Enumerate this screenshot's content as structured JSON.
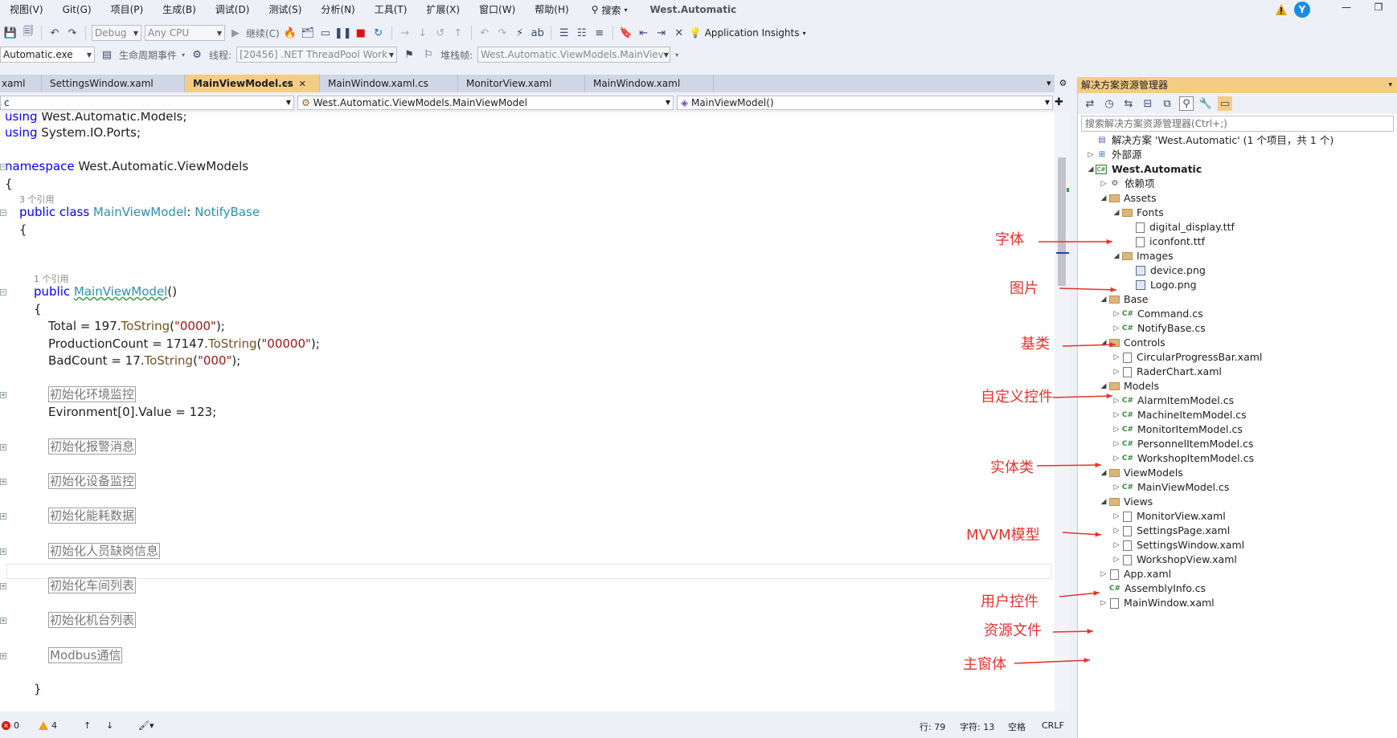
{
  "menubar": {
    "items": [
      "视图(V)",
      "Git(G)",
      "项目(P)",
      "生成(B)",
      "调试(D)",
      "测试(S)",
      "分析(N)",
      "工具(T)",
      "扩展(X)",
      "窗口(W)",
      "帮助(H)"
    ],
    "search_label": "搜索",
    "solution_title": "West.Automatic",
    "avatar_letter": "Y",
    "minimize": "—",
    "restore": "❐"
  },
  "toolbar": {
    "config": "Debug",
    "platform": "Any CPU",
    "continue_label": "继续(C)",
    "app_insights": "Application Insights",
    "process": "Automatic.exe",
    "lifecycle_label": "生命周期事件",
    "thread_label": "线程:",
    "thread_value": "[20456] .NET ThreadPool Work",
    "stack_label": "堆栈帧:",
    "stack_value": "West.Automatic.ViewModels.MainViev"
  },
  "tabs": [
    {
      "label": "xaml"
    },
    {
      "label": "SettingsWindow.xaml"
    },
    {
      "label": "MainViewModel.cs",
      "active": true
    },
    {
      "label": "MainWindow.xaml.cs"
    },
    {
      "label": "MonitorView.xaml"
    },
    {
      "label": "MainWindow.xaml"
    }
  ],
  "navbar": {
    "left": "c",
    "middle": "West.Automatic.ViewModels.MainViewModel",
    "right": "MainViewModel()"
  },
  "code": {
    "using1_kw": "using",
    "using1_rest": " West.Automatic.Models;",
    "using2_kw": "using",
    "using2_rest": " System.IO.Ports;",
    "ns_kw": "namespace",
    "ns_rest": " West.Automatic.ViewModels",
    "brace_open": "{",
    "class_refs": "3 个引用",
    "class_kw": "public class ",
    "class_name": "MainViewModel",
    "class_colon": ": ",
    "class_base": "NotifyBase",
    "ctor_refs": "1 个引用",
    "ctor_kw": "public ",
    "ctor_name": "MainViewModel",
    "ctor_parens": "()",
    "total_a": "Total = 197.",
    "total_m": "ToString",
    "total_b": "(",
    "total_s": "\"0000\"",
    "total_c": ");",
    "prod_a": "ProductionCount = 17147.",
    "prod_m": "ToString",
    "prod_b": "(",
    "prod_s": "\"00000\"",
    "prod_c": ");",
    "bad_a": "BadCount = 17.",
    "bad_m": "ToString",
    "bad_b": "(",
    "bad_s": "\"000\"",
    "bad_c": ");",
    "region_env": "初始化环境监控",
    "env_line": "Evironment[0].Value = 123;",
    "region_alarm": "初始化报警消息",
    "region_device": "初始化设备监控",
    "region_energy": "初始化能耗数据",
    "region_personnel": "初始化人员缺岗信息",
    "region_workshop": "初始化车间列表",
    "region_machine": "初始化机台列表",
    "region_modbus": "Modbus通信",
    "brace_close": "}"
  },
  "solution_explorer": {
    "title": "解决方案资源管理器",
    "search_placeholder": "搜索解决方案资源管理器(Ctrl+;)",
    "tree": [
      {
        "label": "解决方案 'West.Automatic' (1 个项目，共 1 个)",
        "icon": "solution-icon"
      },
      {
        "label": "外部源",
        "icon": "external-icon"
      },
      {
        "label": "West.Automatic",
        "icon": "project-icon"
      },
      {
        "label": "依赖项",
        "icon": "dependencies-icon"
      },
      {
        "label": "Assets",
        "icon": "folder-icon"
      },
      {
        "label": "Fonts",
        "icon": "folder-icon"
      },
      {
        "label": "digital_display.ttf",
        "icon": "font-file-icon"
      },
      {
        "label": "iconfont.ttf",
        "icon": "font-file-icon"
      },
      {
        "label": "Images",
        "icon": "folder-icon"
      },
      {
        "label": "device.png",
        "icon": "image-file-icon"
      },
      {
        "label": "Logo.png",
        "icon": "image-file-icon"
      },
      {
        "label": "Base",
        "icon": "folder-icon"
      },
      {
        "label": "Command.cs",
        "icon": "csharp-file-icon"
      },
      {
        "label": "NotifyBase.cs",
        "icon": "csharp-file-icon"
      },
      {
        "label": "Controls",
        "icon": "folder-icon"
      },
      {
        "label": "CircularProgressBar.xaml",
        "icon": "xaml-file-icon"
      },
      {
        "label": "RaderChart.xaml",
        "icon": "xaml-file-icon"
      },
      {
        "label": "Models",
        "icon": "folder-icon"
      },
      {
        "label": "AlarmItemModel.cs",
        "icon": "csharp-file-icon"
      },
      {
        "label": "MachineItemModel.cs",
        "icon": "csharp-file-icon"
      },
      {
        "label": "MonitorItemModel.cs",
        "icon": "csharp-file-icon"
      },
      {
        "label": "PersonnelItemModel.cs",
        "icon": "csharp-file-icon"
      },
      {
        "label": "WorkshopItemModel.cs",
        "icon": "csharp-file-icon"
      },
      {
        "label": "ViewModels",
        "icon": "folder-icon"
      },
      {
        "label": "MainViewModel.cs",
        "icon": "csharp-file-icon"
      },
      {
        "label": "Views",
        "icon": "folder-icon"
      },
      {
        "label": "MonitorView.xaml",
        "icon": "xaml-file-icon"
      },
      {
        "label": "SettingsPage.xaml",
        "icon": "xaml-file-icon"
      },
      {
        "label": "SettingsWindow.xaml",
        "icon": "xaml-file-icon"
      },
      {
        "label": "WorkshopView.xaml",
        "icon": "xaml-file-icon"
      },
      {
        "label": "App.xaml",
        "icon": "xaml-file-icon"
      },
      {
        "label": "AssemblyInfo.cs",
        "icon": "csharp-file-icon"
      },
      {
        "label": "MainWindow.xaml",
        "icon": "xaml-file-icon"
      }
    ]
  },
  "annotations": [
    "字体",
    "图片",
    "基类",
    "自定义控件",
    "实体类",
    "MVVM模型",
    "用户控件",
    "资源文件",
    "主窗体"
  ],
  "statusbar": {
    "errors": "0",
    "warnings": "4",
    "line": "行: 79",
    "char": "字符: 13",
    "mode": "空格",
    "eol": "CRLF"
  },
  "colors": {
    "accent_tab": "#f5cc84",
    "annotation": "#e8322c",
    "keyword": "#0000ff",
    "type": "#2b91af",
    "string": "#a31515"
  }
}
